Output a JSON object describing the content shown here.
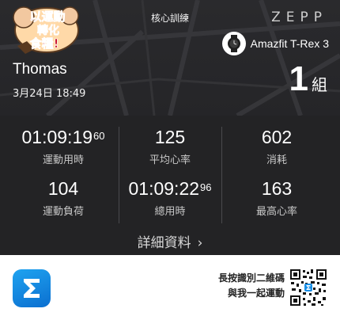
{
  "header": {
    "session_title": "核心訓練",
    "brand": "ZEPP",
    "device_name": "Amazfit T-Rex 3",
    "badge_lines": [
      "以運動",
      "轉化",
      "食糧!"
    ]
  },
  "user": {
    "name": "Thomas",
    "datetime": "3月24日 18:49"
  },
  "sets": {
    "value": "1",
    "unit": "組"
  },
  "stats": [
    {
      "value": "01:09:19",
      "sup": "60",
      "label": "運動用時"
    },
    {
      "value": "125",
      "sup": "",
      "label": "平均心率"
    },
    {
      "value": "602",
      "sup": "",
      "label": "消耗"
    },
    {
      "value": "104",
      "sup": "",
      "label": "運動負荷"
    },
    {
      "value": "01:09:22",
      "sup": "96",
      "label": "總用時"
    },
    {
      "value": "163",
      "sup": "",
      "label": "最高心率"
    }
  ],
  "more_label": "詳細資料",
  "footer": {
    "qr_line1": "長按識別二維碼",
    "qr_line2": "與我一起運動"
  },
  "colors": {
    "card_bg": "#232325",
    "app_icon": "#1a8fe6"
  }
}
